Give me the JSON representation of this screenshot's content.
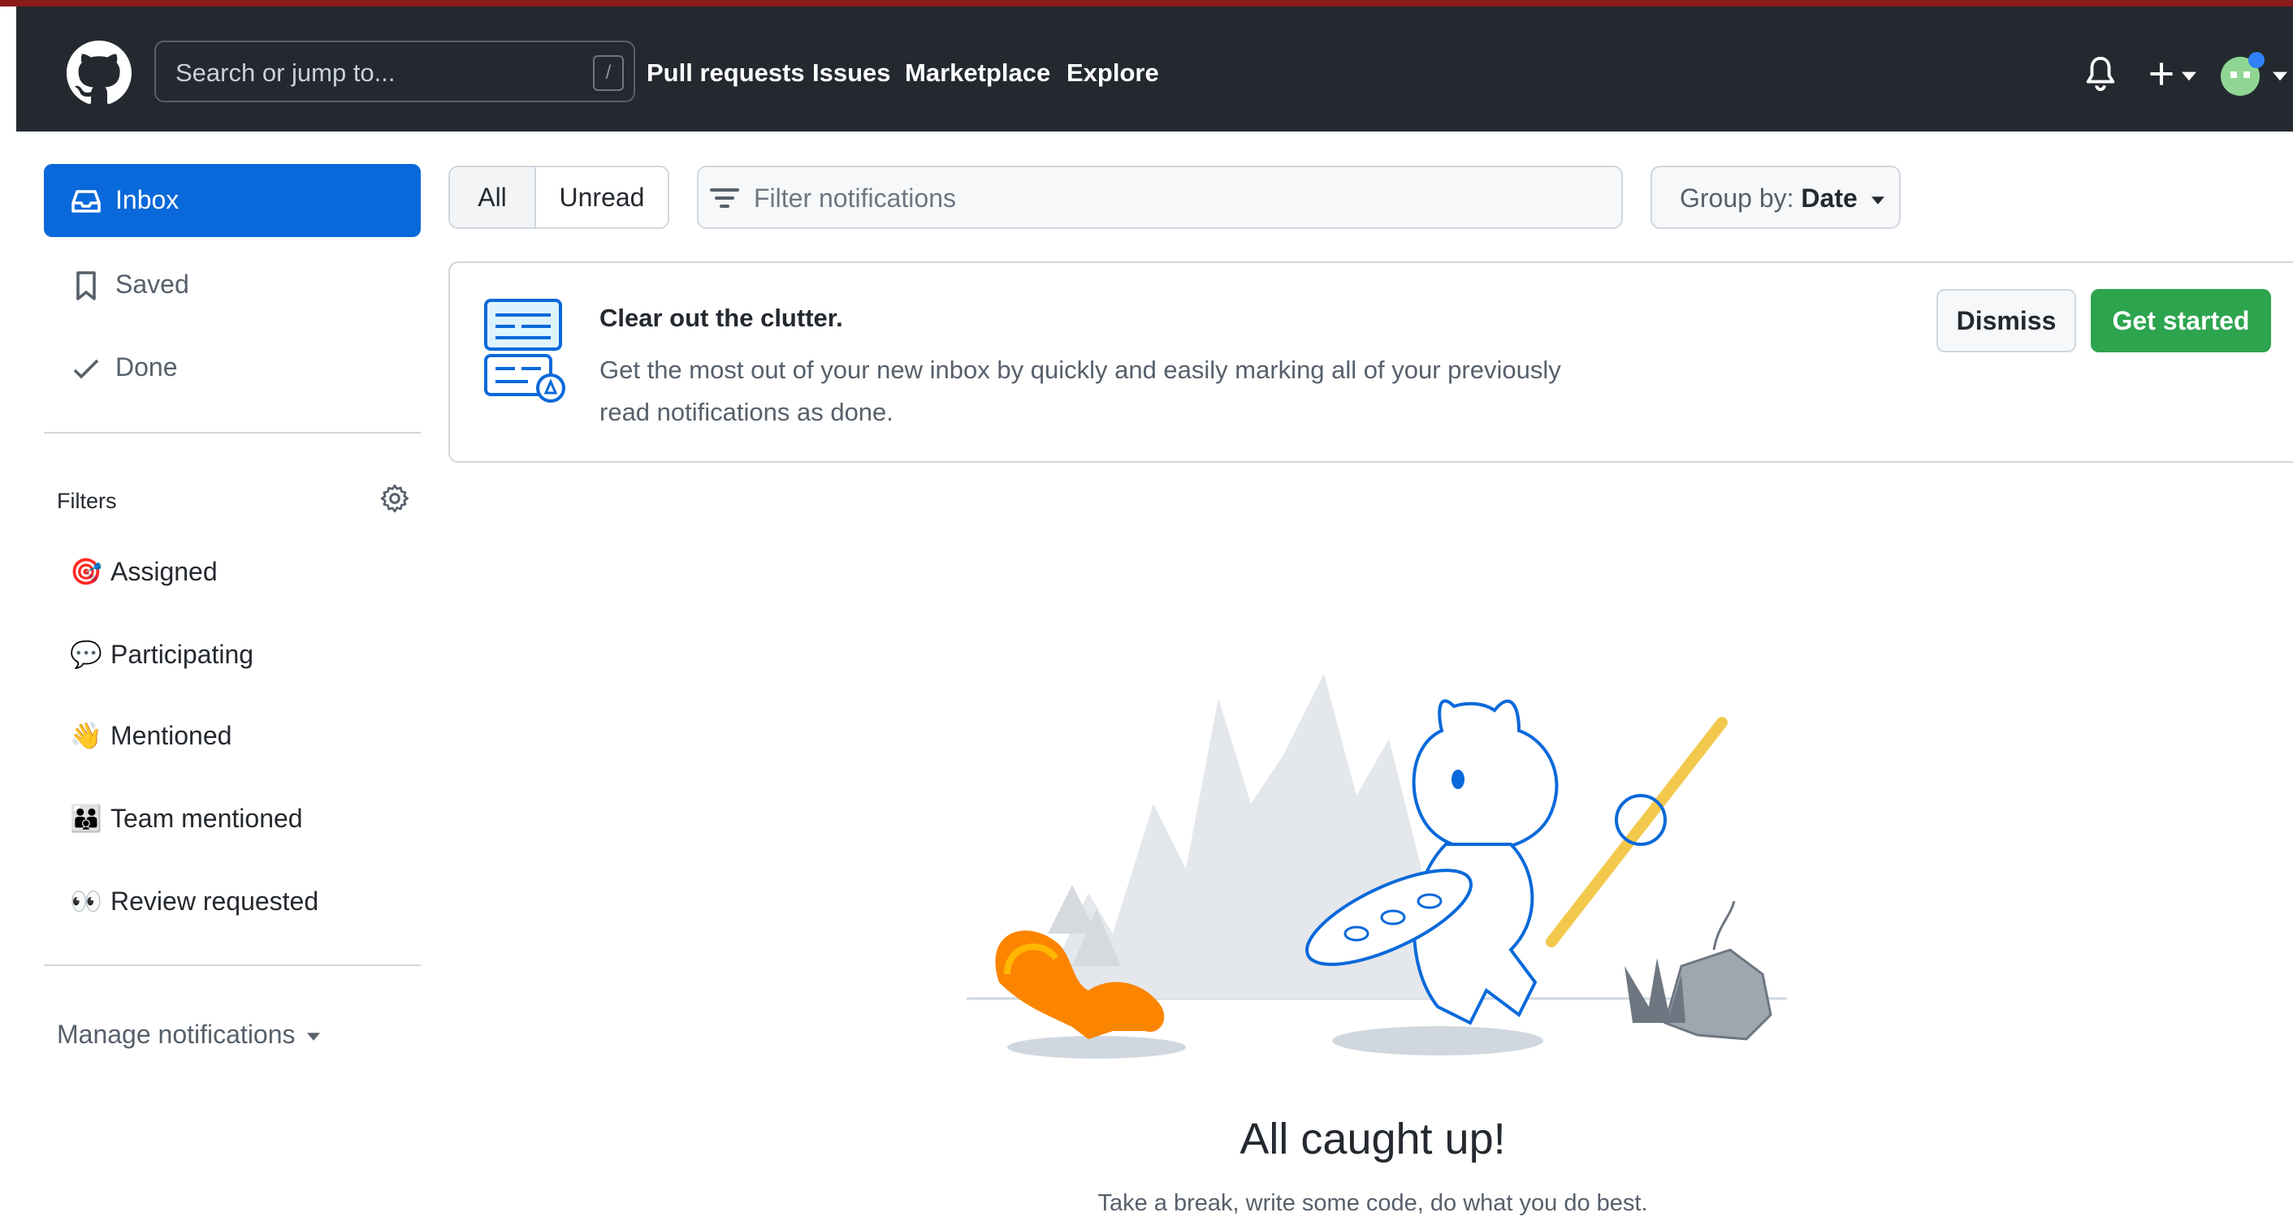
{
  "header": {
    "search_placeholder": "Search or jump to...",
    "search_shortcut": "/",
    "nav": [
      "Pull requests",
      "Issues",
      "Marketplace",
      "Explore"
    ],
    "icons": [
      "github-logo-icon",
      "bell-icon",
      "plus-icon",
      "caret-down-icon",
      "avatar"
    ]
  },
  "sidebar": {
    "items": [
      {
        "label": "Inbox",
        "icon": "inbox-icon",
        "active": true
      },
      {
        "label": "Saved",
        "icon": "bookmark-icon",
        "active": false
      },
      {
        "label": "Done",
        "icon": "check-icon",
        "active": false
      }
    ],
    "filters_title": "Filters",
    "filters": [
      {
        "label": "Assigned",
        "emoji": "🎯"
      },
      {
        "label": "Participating",
        "emoji": "💬"
      },
      {
        "label": "Mentioned",
        "emoji": "👋"
      },
      {
        "label": "Team mentioned",
        "emoji": "👪"
      },
      {
        "label": "Review requested",
        "emoji": "👀"
      }
    ],
    "manage_label": "Manage notifications"
  },
  "toolbar": {
    "all_label": "All",
    "unread_label": "Unread",
    "filter_placeholder": "Filter notifications",
    "group_by_prefix": "Group by:",
    "group_by_value": "Date"
  },
  "banner": {
    "title": "Clear out the clutter.",
    "description": "Get the most out of your new inbox by quickly and easily marking all of your previously read notifications as done.",
    "dismiss_label": "Dismiss",
    "get_started_label": "Get started"
  },
  "empty_state": {
    "title": "All caught up!",
    "subtitle": "Take a break, write some code, do what you do best."
  },
  "colors": {
    "header_bg": "#24292f",
    "accent_blue": "#0969da",
    "primary_green": "#2da44e"
  }
}
